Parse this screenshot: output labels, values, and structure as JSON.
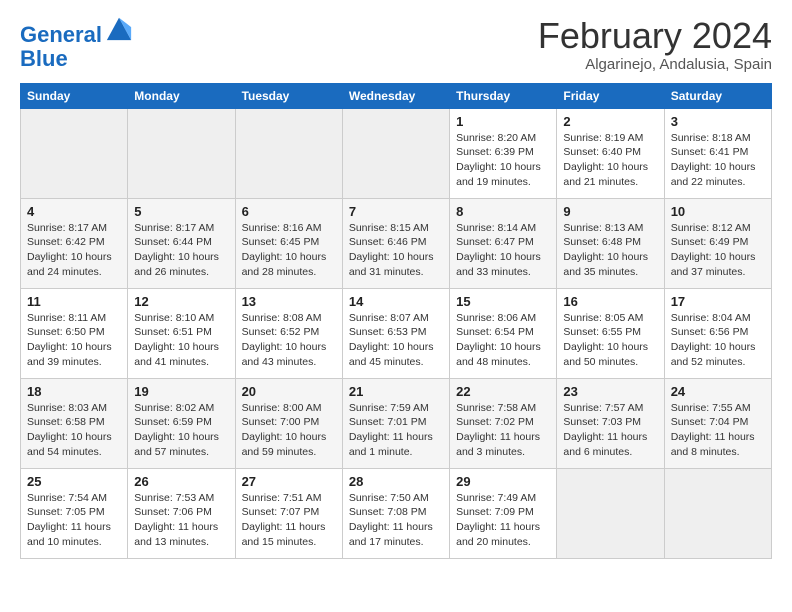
{
  "header": {
    "logo_line1": "General",
    "logo_line2": "Blue",
    "month_year": "February 2024",
    "location": "Algarinejo, Andalusia, Spain"
  },
  "days_of_week": [
    "Sunday",
    "Monday",
    "Tuesday",
    "Wednesday",
    "Thursday",
    "Friday",
    "Saturday"
  ],
  "weeks": [
    [
      {
        "day": "",
        "info": ""
      },
      {
        "day": "",
        "info": ""
      },
      {
        "day": "",
        "info": ""
      },
      {
        "day": "",
        "info": ""
      },
      {
        "day": "1",
        "info": "Sunrise: 8:20 AM\nSunset: 6:39 PM\nDaylight: 10 hours\nand 19 minutes."
      },
      {
        "day": "2",
        "info": "Sunrise: 8:19 AM\nSunset: 6:40 PM\nDaylight: 10 hours\nand 21 minutes."
      },
      {
        "day": "3",
        "info": "Sunrise: 8:18 AM\nSunset: 6:41 PM\nDaylight: 10 hours\nand 22 minutes."
      }
    ],
    [
      {
        "day": "4",
        "info": "Sunrise: 8:17 AM\nSunset: 6:42 PM\nDaylight: 10 hours\nand 24 minutes."
      },
      {
        "day": "5",
        "info": "Sunrise: 8:17 AM\nSunset: 6:44 PM\nDaylight: 10 hours\nand 26 minutes."
      },
      {
        "day": "6",
        "info": "Sunrise: 8:16 AM\nSunset: 6:45 PM\nDaylight: 10 hours\nand 28 minutes."
      },
      {
        "day": "7",
        "info": "Sunrise: 8:15 AM\nSunset: 6:46 PM\nDaylight: 10 hours\nand 31 minutes."
      },
      {
        "day": "8",
        "info": "Sunrise: 8:14 AM\nSunset: 6:47 PM\nDaylight: 10 hours\nand 33 minutes."
      },
      {
        "day": "9",
        "info": "Sunrise: 8:13 AM\nSunset: 6:48 PM\nDaylight: 10 hours\nand 35 minutes."
      },
      {
        "day": "10",
        "info": "Sunrise: 8:12 AM\nSunset: 6:49 PM\nDaylight: 10 hours\nand 37 minutes."
      }
    ],
    [
      {
        "day": "11",
        "info": "Sunrise: 8:11 AM\nSunset: 6:50 PM\nDaylight: 10 hours\nand 39 minutes."
      },
      {
        "day": "12",
        "info": "Sunrise: 8:10 AM\nSunset: 6:51 PM\nDaylight: 10 hours\nand 41 minutes."
      },
      {
        "day": "13",
        "info": "Sunrise: 8:08 AM\nSunset: 6:52 PM\nDaylight: 10 hours\nand 43 minutes."
      },
      {
        "day": "14",
        "info": "Sunrise: 8:07 AM\nSunset: 6:53 PM\nDaylight: 10 hours\nand 45 minutes."
      },
      {
        "day": "15",
        "info": "Sunrise: 8:06 AM\nSunset: 6:54 PM\nDaylight: 10 hours\nand 48 minutes."
      },
      {
        "day": "16",
        "info": "Sunrise: 8:05 AM\nSunset: 6:55 PM\nDaylight: 10 hours\nand 50 minutes."
      },
      {
        "day": "17",
        "info": "Sunrise: 8:04 AM\nSunset: 6:56 PM\nDaylight: 10 hours\nand 52 minutes."
      }
    ],
    [
      {
        "day": "18",
        "info": "Sunrise: 8:03 AM\nSunset: 6:58 PM\nDaylight: 10 hours\nand 54 minutes."
      },
      {
        "day": "19",
        "info": "Sunrise: 8:02 AM\nSunset: 6:59 PM\nDaylight: 10 hours\nand 57 minutes."
      },
      {
        "day": "20",
        "info": "Sunrise: 8:00 AM\nSunset: 7:00 PM\nDaylight: 10 hours\nand 59 minutes."
      },
      {
        "day": "21",
        "info": "Sunrise: 7:59 AM\nSunset: 7:01 PM\nDaylight: 11 hours\nand 1 minute."
      },
      {
        "day": "22",
        "info": "Sunrise: 7:58 AM\nSunset: 7:02 PM\nDaylight: 11 hours\nand 3 minutes."
      },
      {
        "day": "23",
        "info": "Sunrise: 7:57 AM\nSunset: 7:03 PM\nDaylight: 11 hours\nand 6 minutes."
      },
      {
        "day": "24",
        "info": "Sunrise: 7:55 AM\nSunset: 7:04 PM\nDaylight: 11 hours\nand 8 minutes."
      }
    ],
    [
      {
        "day": "25",
        "info": "Sunrise: 7:54 AM\nSunset: 7:05 PM\nDaylight: 11 hours\nand 10 minutes."
      },
      {
        "day": "26",
        "info": "Sunrise: 7:53 AM\nSunset: 7:06 PM\nDaylight: 11 hours\nand 13 minutes."
      },
      {
        "day": "27",
        "info": "Sunrise: 7:51 AM\nSunset: 7:07 PM\nDaylight: 11 hours\nand 15 minutes."
      },
      {
        "day": "28",
        "info": "Sunrise: 7:50 AM\nSunset: 7:08 PM\nDaylight: 11 hours\nand 17 minutes."
      },
      {
        "day": "29",
        "info": "Sunrise: 7:49 AM\nSunset: 7:09 PM\nDaylight: 11 hours\nand 20 minutes."
      },
      {
        "day": "",
        "info": ""
      },
      {
        "day": "",
        "info": ""
      }
    ]
  ]
}
